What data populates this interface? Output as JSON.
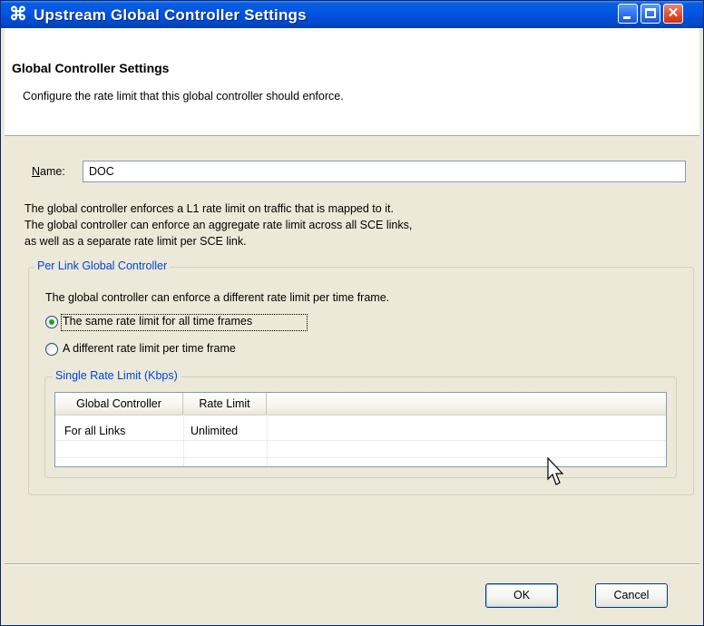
{
  "window": {
    "title": "Upstream Global Controller Settings",
    "icon": "app-icon"
  },
  "header": {
    "title": "Global Controller Settings",
    "description": "Configure the rate limit that this global controller should enforce."
  },
  "name_field": {
    "label": "Name:",
    "value": "DOC"
  },
  "description_lines": [
    "The global controller enforces a L1 rate limit on traffic that is mapped to it.",
    "The global controller can enforce an aggregate rate limit across all SCE links,",
    "as well as a separate rate limit per SCE link."
  ],
  "per_link_group": {
    "legend": "Per Link Global Controller",
    "intro": "The global controller can enforce a different rate limit per time frame.",
    "options": [
      {
        "label": "The same rate limit for all time frames",
        "selected": true
      },
      {
        "label": "A different rate limit per time frame",
        "selected": false
      }
    ]
  },
  "single_rate_group": {
    "legend": "Single Rate Limit (Kbps)",
    "columns": [
      "Global Controller",
      "Rate Limit"
    ],
    "rows": [
      [
        "For all Links",
        "Unlimited"
      ]
    ]
  },
  "buttons": {
    "ok": "OK",
    "cancel": "Cancel"
  }
}
